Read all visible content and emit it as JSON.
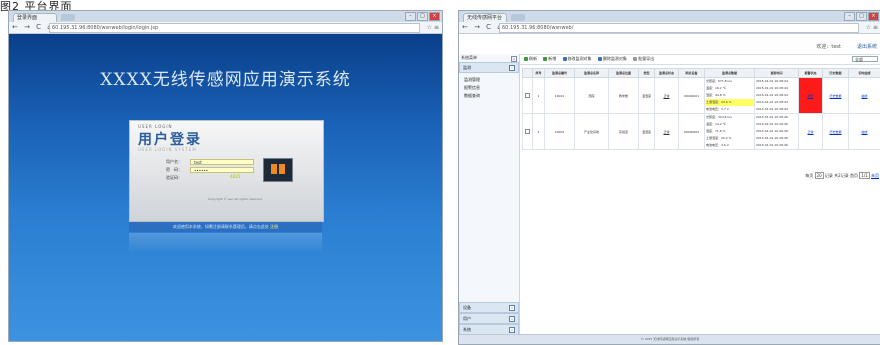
{
  "caption": "图2 平台界面",
  "left": {
    "tab_title": "登录界面",
    "nav": "← → C ⌂",
    "url": "60.195.31.96:8080/wsnweb/login/login.jsp",
    "tools": "☆ ≡",
    "winbtns": {
      "min": "–",
      "max": "□",
      "close": "×"
    },
    "system_title": "XXXX无线传感网应用演示系统",
    "login": {
      "user_login": "USER LOGIN",
      "logo_text": "用户登录",
      "logo_sub": "USER LOGIN SYSTEM",
      "username_label": "用户名：",
      "username_value": "test",
      "password_label": "密　码：",
      "password_value": "••••••",
      "verify_label": "验证码：",
      "verify_code": "4825",
      "copyright": "Copyright © wsn All rights reserved.",
      "link_prefix": "欢迎使用本系统，如需注册请联系管理员，请点击此处",
      "link_text": "注册"
    }
  },
  "right": {
    "tab_title": "无线传感网平台",
    "nav": "← → C ⌂",
    "url": "60.195.31.96:8080/wsnweb/",
    "tools": "☆ ≡",
    "winbtns": {
      "min": "–",
      "max": "□",
      "close": "×"
    },
    "header": {
      "user_info": "欢迎：test",
      "user_link": "退出系统"
    },
    "sidebar": {
      "title": "系统菜单",
      "group": "监测",
      "items": [
        "监测管理",
        "报警信息",
        "数据查询"
      ],
      "bottom_groups": [
        "设备",
        "用户",
        "系统"
      ]
    },
    "toolbar": {
      "items": [
        "刷新",
        "新增",
        "修改监测对象",
        "删除监测对象",
        "批量导出"
      ],
      "filter": "全部"
    },
    "table": {
      "headers": [
        "",
        "序号",
        "监测点编号",
        "监测点名称",
        "监测点位置",
        "类型",
        "监测点状态",
        "网关设备",
        "监测点数据",
        "更新时间",
        "报警状态",
        "历史数据",
        "实时曲线"
      ],
      "rows": [
        {
          "index": "1",
          "code": "10001",
          "name": "西院",
          "location": "教学楼",
          "type": "温湿度",
          "status": "正常",
          "gateway": "00000001",
          "data": [
            {
              "text": "光照度：671.8 lux",
              "highlight": false
            },
            {
              "text": "温度：16.2 ℃",
              "highlight": false
            },
            {
              "text": "湿度：44.8 %",
              "highlight": false
            },
            {
              "text": "土壤湿度：23.6 %",
              "highlight": true
            },
            {
              "text": "电池电压：3.7 V",
              "highlight": false
            }
          ],
          "times": [
            "2015-01-01 10:28:44",
            "2015-01-01 10:28:44",
            "2015-01-01 10:28:44",
            "2015-01-01 10:28:44",
            "2015-01-01 10:28:44"
          ],
          "alarm": "报警",
          "history": "历史数据",
          "curve": "曲线"
        },
        {
          "index": "2",
          "code": "10002",
          "name": "产业化基地",
          "location": "实验室",
          "type": "温湿度",
          "status": "正常",
          "gateway": "00000002",
          "data": [
            {
              "text": "光照度：324.6 lux",
              "highlight": false
            },
            {
              "text": "温度：14.2 ℃",
              "highlight": false
            },
            {
              "text": "湿度：71.6 %",
              "highlight": false
            },
            {
              "text": "土壤湿度：30.2 %",
              "highlight": false
            },
            {
              "text": "电池电压：3.6 V",
              "highlight": false
            }
          ],
          "times": [
            "2015-01-01 10:26:46",
            "2015-01-01 10:26:46",
            "2015-01-01 10:26:46",
            "2015-01-01 10:26:46",
            "2015-01-01 10:26:46"
          ],
          "alarm": "正常",
          "history": "历史数据",
          "curve": "曲线"
        }
      ]
    },
    "pager": {
      "prefix": "每页",
      "size": "20",
      "mid": "记录  共2记录  首页",
      "page": "1/1",
      "suffix": "末页"
    },
    "footer": "© 2015 无线传感网应用演示系统 版权所有"
  },
  "colors": {
    "login_bg": "#1a62b8",
    "alarm_red": "#ff1a1a",
    "highlight_yellow": "#ffff66",
    "link_blue": "#0033cc"
  }
}
